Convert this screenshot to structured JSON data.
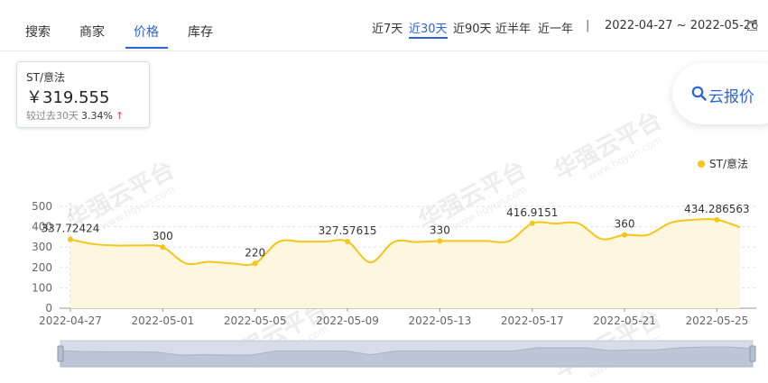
{
  "tabs": [
    {
      "label": "搜索",
      "active": false
    },
    {
      "label": "商家",
      "active": false
    },
    {
      "label": "价格",
      "active": true
    },
    {
      "label": "库存",
      "active": false
    }
  ],
  "ranges": [
    {
      "label": "近7天",
      "active": false
    },
    {
      "label": "近30天",
      "active": true
    },
    {
      "label": "近90天",
      "active": false
    },
    {
      "label": "近半年",
      "active": false
    },
    {
      "label": "近一年",
      "active": false
    }
  ],
  "separator": "|",
  "date_range": "2022-04-27 ~ 2022-05-26",
  "icons": {
    "calendar": "calendar-icon",
    "search": "search-icon",
    "arrow_up": "arrow-up-icon"
  },
  "price_card": {
    "name": "ST/意法",
    "price": "￥319.555",
    "change_label": "较过去30天",
    "change_pct": "3.34%",
    "arrow": "↑"
  },
  "quote_button": {
    "label": "云报价"
  },
  "colors": {
    "accent": "#2b63d9",
    "series": "#f5c518",
    "area": "#fdf7e0",
    "up": "#e8405b"
  },
  "chart_data": {
    "type": "line",
    "series": [
      {
        "name": "ST/意法",
        "x": [
          "2022-04-27",
          "2022-04-28",
          "2022-04-29",
          "2022-04-30",
          "2022-05-01",
          "2022-05-02",
          "2022-05-03",
          "2022-05-04",
          "2022-05-05",
          "2022-05-06",
          "2022-05-07",
          "2022-05-08",
          "2022-05-09",
          "2022-05-10",
          "2022-05-11",
          "2022-05-12",
          "2022-05-13",
          "2022-05-14",
          "2022-05-15",
          "2022-05-16",
          "2022-05-17",
          "2022-05-18",
          "2022-05-19",
          "2022-05-20",
          "2022-05-21",
          "2022-05-22",
          "2022-05-23",
          "2022-05-24",
          "2022-05-25",
          "2022-05-26"
        ],
        "values": [
          337.72424,
          315,
          308,
          308,
          300,
          220,
          228,
          220,
          220,
          325,
          327,
          327,
          327.57615,
          225,
          325,
          325,
          330,
          330,
          330,
          330,
          416.9151,
          416,
          416,
          340,
          360,
          360,
          420,
          434.286563,
          434.286563,
          397
        ]
      }
    ],
    "labels": [
      {
        "x": "2022-04-27",
        "text": "337.72424"
      },
      {
        "x": "2022-05-01",
        "text": "300"
      },
      {
        "x": "2022-05-05",
        "text": "220"
      },
      {
        "x": "2022-05-09",
        "text": "327.57615"
      },
      {
        "x": "2022-05-13",
        "text": "330"
      },
      {
        "x": "2022-05-17",
        "text": "416.9151"
      },
      {
        "x": "2022-05-21",
        "text": "360"
      },
      {
        "x": "2022-05-25",
        "text": "434.286563"
      }
    ],
    "x_ticks": [
      "2022-04-27",
      "2022-05-01",
      "2022-05-05",
      "2022-05-09",
      "2022-05-13",
      "2022-05-17",
      "2022-05-21",
      "2022-05-25"
    ],
    "y_ticks": [
      0,
      100,
      200,
      300,
      400,
      500
    ],
    "ylim": [
      0,
      520
    ],
    "legend": "top-right",
    "grid": true,
    "data_zoom": true
  },
  "watermark": {
    "text": "华强云平台",
    "sub": "www.hqyun.com"
  }
}
